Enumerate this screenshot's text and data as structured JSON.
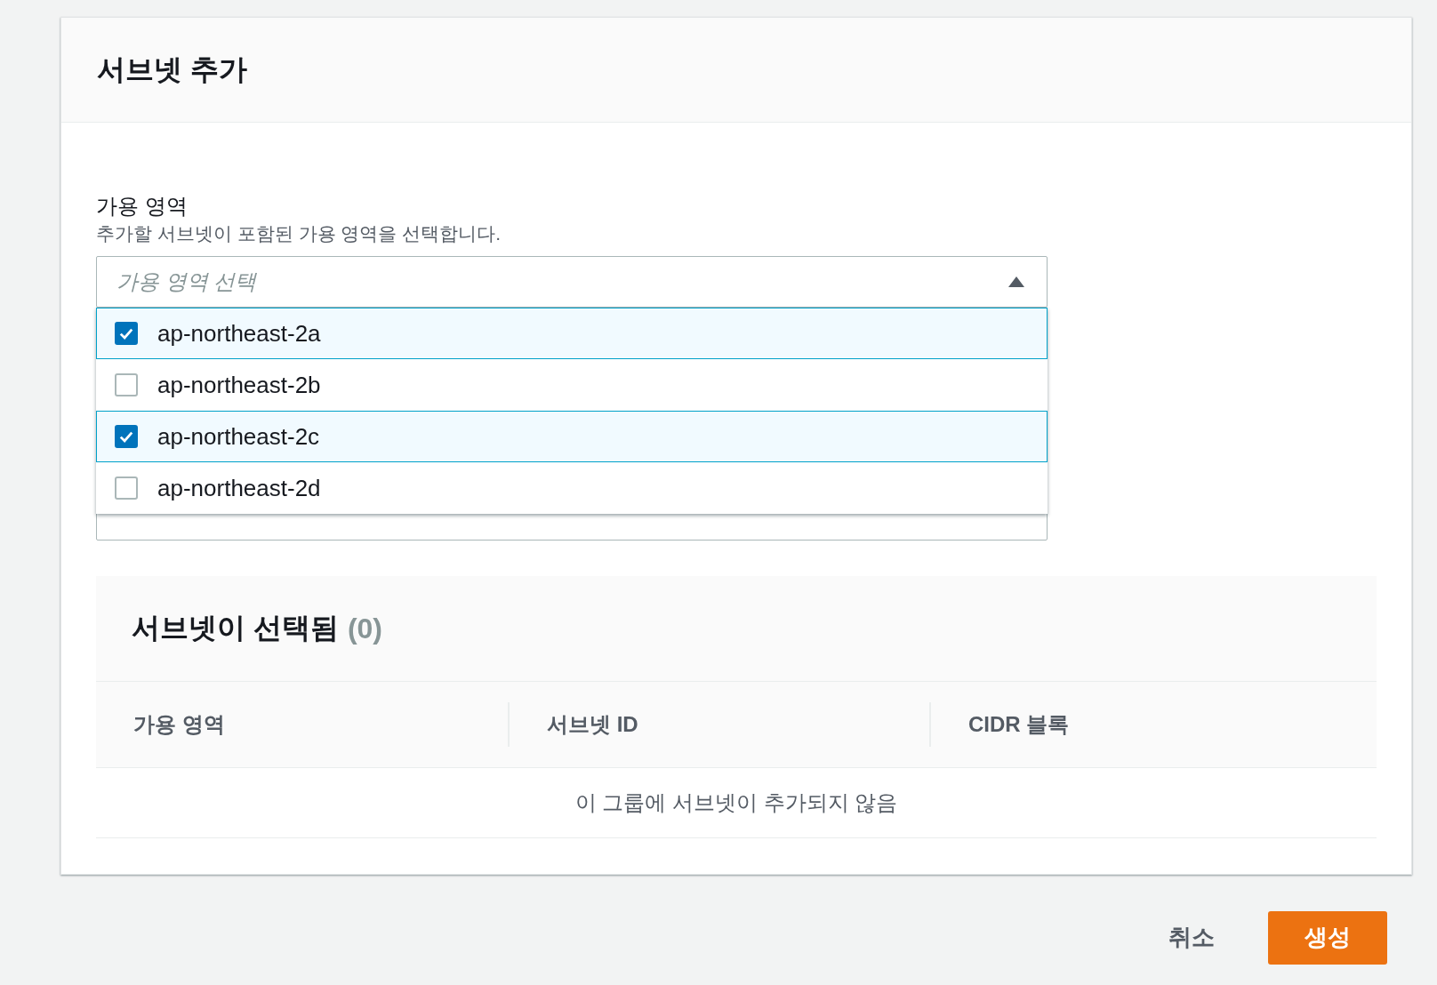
{
  "dialog": {
    "title": "서브넷 추가"
  },
  "availability_zone": {
    "label": "가용 영역",
    "description": "추가할 서브넷이 포함된 가용 영역을 선택합니다.",
    "placeholder": "가용 영역 선택",
    "expanded": true,
    "options": [
      {
        "label": "ap-northeast-2a",
        "checked": true
      },
      {
        "label": "ap-northeast-2b",
        "checked": false
      },
      {
        "label": "ap-northeast-2c",
        "checked": true
      },
      {
        "label": "ap-northeast-2d",
        "checked": false
      }
    ]
  },
  "selected_subnets": {
    "title": "서브넷이 선택됨",
    "count": "(0)",
    "columns": [
      "가용 영역",
      "서브넷 ID",
      "CIDR 블록"
    ],
    "empty_message": "이 그룹에 서브넷이 추가되지 않음"
  },
  "buttons": {
    "cancel": "취소",
    "create": "생성"
  }
}
